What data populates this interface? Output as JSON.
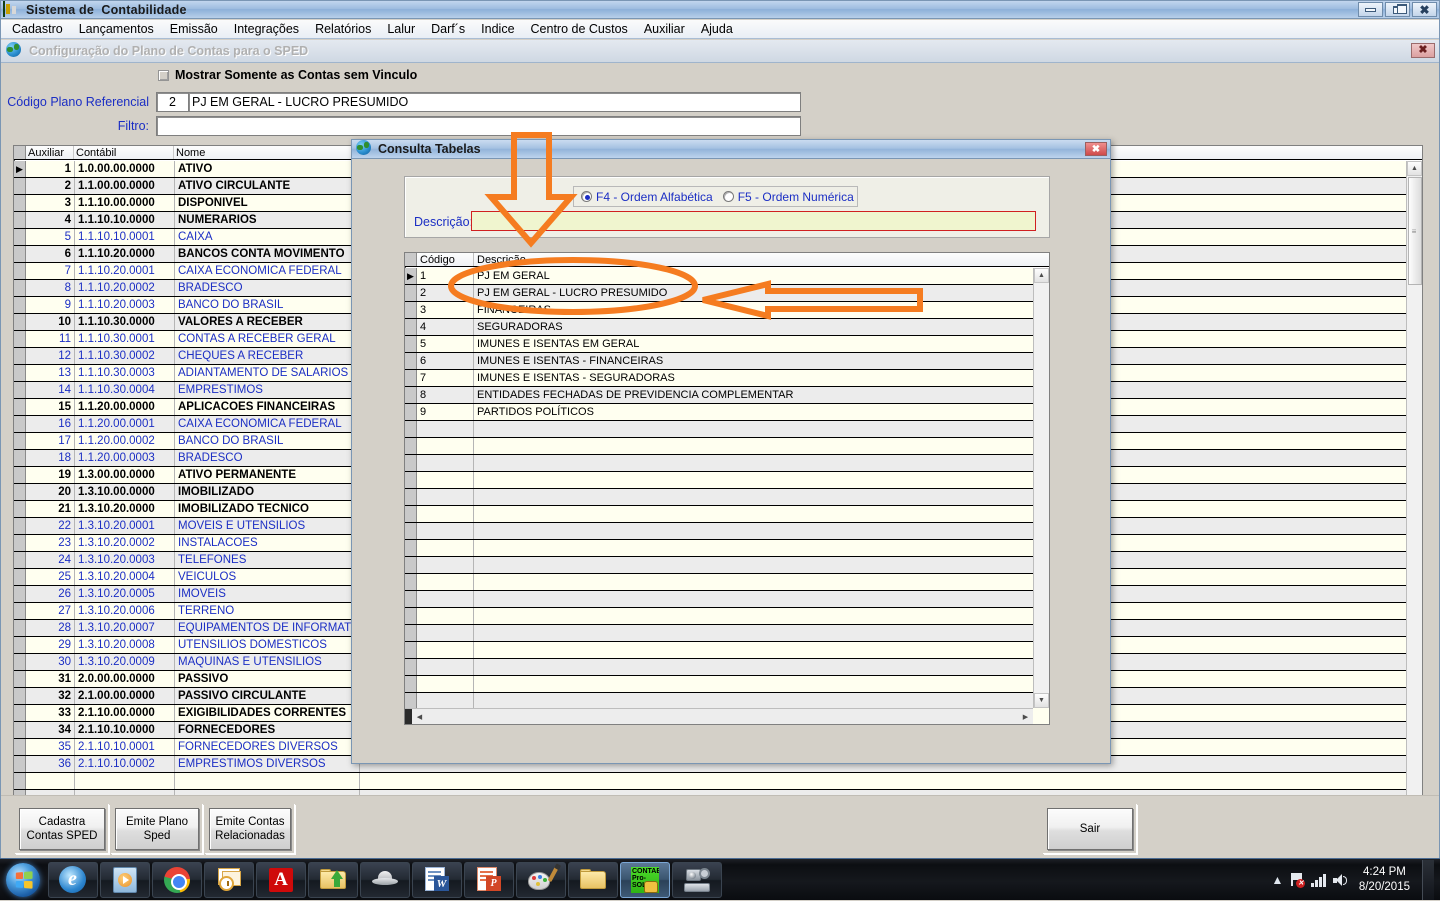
{
  "window": {
    "title": "Sistema de  Contabilidade",
    "minimize_label": "Minimizar",
    "maximize_label": "Restaurar",
    "close_label": "X"
  },
  "menubar": {
    "items": [
      "Cadastro",
      "Lançamentos",
      "Emissão",
      "Integrações",
      "Relatórios",
      "Lalur",
      "Darf´s",
      "Indice",
      "Centro de Custos",
      "Auxiliar",
      "Ajuda"
    ]
  },
  "mdi": {
    "title": "Configuração do Plano de Contas para o SPED",
    "close_label": "X"
  },
  "form": {
    "checkbox_label": "Mostrar Somente as Contas sem Vinculo",
    "checkbox_accesskey": "M",
    "checkbox_checked": false,
    "codigo_plano_label": "Código Plano Referencial",
    "codigo_plano_value": "2",
    "descricao_plano_value": "PJ EM GERAL - LUCRO PRESUMIDO",
    "filtro_label": "Filtro:",
    "filtro_value": ""
  },
  "grid": {
    "columns": [
      "Auxiliar",
      "Contábil",
      "Nome"
    ],
    "selected_row_index": 0,
    "rows": [
      {
        "aux": "1",
        "contabil": "1.0.00.00.0000",
        "nome": "ATIVO",
        "type": "sintetica"
      },
      {
        "aux": "2",
        "contabil": "1.1.00.00.0000",
        "nome": "ATIVO CIRCULANTE",
        "type": "sintetica"
      },
      {
        "aux": "3",
        "contabil": "1.1.10.00.0000",
        "nome": "DISPONIVEL",
        "type": "sintetica"
      },
      {
        "aux": "4",
        "contabil": "1.1.10.10.0000",
        "nome": "NUMERARIOS",
        "type": "sintetica"
      },
      {
        "aux": "5",
        "contabil": "1.1.10.10.0001",
        "nome": "CAIXA",
        "type": "analitica"
      },
      {
        "aux": "6",
        "contabil": "1.1.10.20.0000",
        "nome": "BANCOS CONTA MOVIMENTO",
        "type": "sintetica"
      },
      {
        "aux": "7",
        "contabil": "1.1.10.20.0001",
        "nome": "CAIXA ECONOMICA FEDERAL",
        "type": "analitica"
      },
      {
        "aux": "8",
        "contabil": "1.1.10.20.0002",
        "nome": "BRADESCO",
        "type": "analitica"
      },
      {
        "aux": "9",
        "contabil": "1.1.10.20.0003",
        "nome": "BANCO DO BRASIL",
        "type": "analitica"
      },
      {
        "aux": "10",
        "contabil": "1.1.10.30.0000",
        "nome": "VALORES A RECEBER",
        "type": "sintetica"
      },
      {
        "aux": "11",
        "contabil": "1.1.10.30.0001",
        "nome": "CONTAS A RECEBER GERAL",
        "type": "analitica"
      },
      {
        "aux": "12",
        "contabil": "1.1.10.30.0002",
        "nome": "CHEQUES A RECEBER",
        "type": "analitica"
      },
      {
        "aux": "13",
        "contabil": "1.1.10.30.0003",
        "nome": "ADIANTAMENTO DE SALARIOS",
        "type": "analitica"
      },
      {
        "aux": "14",
        "contabil": "1.1.10.30.0004",
        "nome": "EMPRESTIMOS",
        "type": "analitica"
      },
      {
        "aux": "15",
        "contabil": "1.1.20.00.0000",
        "nome": "APLICACOES FINANCEIRAS",
        "type": "sintetica"
      },
      {
        "aux": "16",
        "contabil": "1.1.20.00.0001",
        "nome": "CAIXA ECONOMICA FEDERAL",
        "type": "analitica"
      },
      {
        "aux": "17",
        "contabil": "1.1.20.00.0002",
        "nome": "BANCO DO BRASIL",
        "type": "analitica"
      },
      {
        "aux": "18",
        "contabil": "1.1.20.00.0003",
        "nome": "BRADESCO",
        "type": "analitica"
      },
      {
        "aux": "19",
        "contabil": "1.3.00.00.0000",
        "nome": "ATIVO PERMANENTE",
        "type": "sintetica"
      },
      {
        "aux": "20",
        "contabil": "1.3.10.00.0000",
        "nome": "IMOBILIZADO",
        "type": "sintetica"
      },
      {
        "aux": "21",
        "contabil": "1.3.10.20.0000",
        "nome": "IMOBILIZADO TECNICO",
        "type": "sintetica"
      },
      {
        "aux": "22",
        "contabil": "1.3.10.20.0001",
        "nome": "MOVEIS E UTENSILIOS",
        "type": "analitica"
      },
      {
        "aux": "23",
        "contabil": "1.3.10.20.0002",
        "nome": "INSTALACOES",
        "type": "analitica"
      },
      {
        "aux": "24",
        "contabil": "1.3.10.20.0003",
        "nome": "TELEFONES",
        "type": "analitica"
      },
      {
        "aux": "25",
        "contabil": "1.3.10.20.0004",
        "nome": "VEICULOS",
        "type": "analitica"
      },
      {
        "aux": "26",
        "contabil": "1.3.10.20.0005",
        "nome": "IMOVEIS",
        "type": "analitica"
      },
      {
        "aux": "27",
        "contabil": "1.3.10.20.0006",
        "nome": "TERRENO",
        "type": "analitica"
      },
      {
        "aux": "28",
        "contabil": "1.3.10.20.0007",
        "nome": "EQUIPAMENTOS DE INFORMATICA",
        "type": "analitica"
      },
      {
        "aux": "29",
        "contabil": "1.3.10.20.0008",
        "nome": "UTENSILIOS DOMESTICOS",
        "type": "analitica"
      },
      {
        "aux": "30",
        "contabil": "1.3.10.20.0009",
        "nome": "MAQUINAS E UTENSILIOS",
        "type": "analitica"
      },
      {
        "aux": "31",
        "contabil": "2.0.00.00.0000",
        "nome": "PASSIVO",
        "type": "sintetica"
      },
      {
        "aux": "32",
        "contabil": "2.1.00.00.0000",
        "nome": "PASSIVO CIRCULANTE",
        "type": "sintetica"
      },
      {
        "aux": "33",
        "contabil": "2.1.10.00.0000",
        "nome": "EXIGIBILIDADES CORRENTES",
        "type": "sintetica"
      },
      {
        "aux": "34",
        "contabil": "2.1.10.10.0000",
        "nome": "FORNECEDORES",
        "type": "sintetica"
      },
      {
        "aux": "35",
        "contabil": "2.1.10.10.0001",
        "nome": "FORNECEDORES DIVERSOS",
        "type": "analitica"
      },
      {
        "aux": "36",
        "contabil": "2.1.10.10.0002",
        "nome": "EMPRESTIMOS DIVERSOS",
        "type": "analitica"
      }
    ]
  },
  "buttons": {
    "cadastra_contas_sped": "Cadastra\nContas SPED",
    "cadastra_line1": "Cadastra",
    "cadastra_line2": "Contas SPED",
    "emite_plano_line1": "Emite Plano",
    "emite_plano_line2": "Sped",
    "emite_contas_line1": "Emite Contas",
    "emite_contas_line2": "Relacionadas",
    "sair": "Sair"
  },
  "dialog": {
    "title": "Consulta Tabelas",
    "close_label": "X",
    "radio_alfabetica": "F4 - Ordem Alfabética",
    "radio_alfabetica_accesskey": "A",
    "radio_numerica": "F5 - Ordem Numérica",
    "radio_numerica_accesskey": "N",
    "selected_order": "alfabetica",
    "descricao_label": "Descrição:",
    "descricao_value": "",
    "columns": [
      "Código",
      "Descrição"
    ],
    "selected_row_index": 0,
    "rows": [
      {
        "codigo": "1",
        "descricao": "PJ EM GERAL"
      },
      {
        "codigo": "2",
        "descricao": "PJ EM GERAL - LUCRO PRESUMIDO"
      },
      {
        "codigo": "3",
        "descricao": "FINANCEIRAS"
      },
      {
        "codigo": "4",
        "descricao": "SEGURADORAS"
      },
      {
        "codigo": "5",
        "descricao": "IMUNES E ISENTAS EM GERAL"
      },
      {
        "codigo": "6",
        "descricao": "IMUNES E ISENTAS - FINANCEIRAS"
      },
      {
        "codigo": "7",
        "descricao": "IMUNES E ISENTAS - SEGURADORAS"
      },
      {
        "codigo": "8",
        "descricao": "ENTIDADES FECHADAS DE PREVIDENCIA COMPLEMENTAR"
      },
      {
        "codigo": "9",
        "descricao": "PARTIDOS POLÍTICOS"
      }
    ],
    "empty_row_count": 18
  },
  "annotations": {
    "color": "#F57C20",
    "items": [
      {
        "name": "down-arrow-to-descricao",
        "shape": "arrow-down"
      },
      {
        "name": "ellipse-around-pj-em-geral-rows",
        "shape": "ellipse"
      },
      {
        "name": "left-arrow-to-lucro-presumido-row",
        "shape": "arrow-left"
      }
    ]
  },
  "taskbar": {
    "start_label": "Iniciar",
    "apps": [
      {
        "name": "internet-explorer",
        "label": "Internet Explorer",
        "active": false
      },
      {
        "name": "windows-media-player",
        "label": "Windows Media Player",
        "active": false
      },
      {
        "name": "google-chrome",
        "label": "Google Chrome",
        "active": false
      },
      {
        "name": "microsoft-outlook",
        "label": "Microsoft Outlook",
        "active": false
      },
      {
        "name": "adobe-reader",
        "label": "Adobe Reader",
        "active": false
      },
      {
        "name": "folder-upload",
        "label": "Pasta",
        "active": false
      },
      {
        "name": "saucer-app",
        "label": "Aplicativo",
        "active": false
      },
      {
        "name": "microsoft-word",
        "label": "Microsoft Word",
        "active": false
      },
      {
        "name": "microsoft-powerpoint",
        "label": "Microsoft PowerPoint",
        "active": false
      },
      {
        "name": "paint",
        "label": "Paint",
        "active": false
      },
      {
        "name": "explorer-folder",
        "label": "Windows Explorer",
        "active": false
      },
      {
        "name": "contab-prosol",
        "label": "CONTAB Pro-Sol",
        "active": true
      },
      {
        "name": "scanner-camera",
        "label": "Scanner",
        "active": false
      }
    ],
    "contab_icon_text": [
      "CONTAB",
      "Pro-",
      "SOL"
    ],
    "tray": {
      "show_hidden": "▲",
      "network_status": "Sem conexão",
      "signal": "Sinal",
      "volume": "Volume",
      "time": "4:24 PM",
      "date": "8/20/2015"
    }
  }
}
